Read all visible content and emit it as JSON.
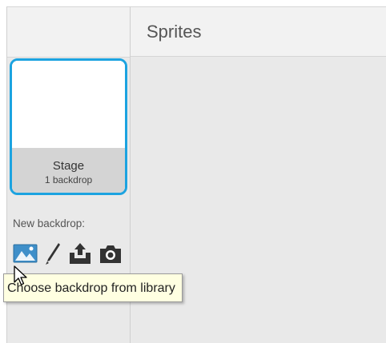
{
  "sprites_panel": {
    "title": "Sprites"
  },
  "stage": {
    "name": "Stage",
    "backdrop_count": "1 backdrop",
    "selected_border_color": "#1ca3e0"
  },
  "new_backdrop": {
    "label": "New backdrop:",
    "buttons": [
      {
        "icon": "landscape-library-icon",
        "action": "choose-from-library"
      },
      {
        "icon": "paintbrush-icon",
        "action": "paint-new"
      },
      {
        "icon": "upload-icon",
        "action": "upload-from-file"
      },
      {
        "icon": "camera-icon",
        "action": "new-from-camera"
      }
    ]
  },
  "tooltip": {
    "text": "Choose backdrop from library"
  },
  "colors": {
    "panel_bg": "#e9e9e9",
    "header_bg": "#f2f2f2",
    "accent": "#1ca3e0",
    "icon_dark": "#333333",
    "tooltip_bg": "#ffffe1"
  }
}
